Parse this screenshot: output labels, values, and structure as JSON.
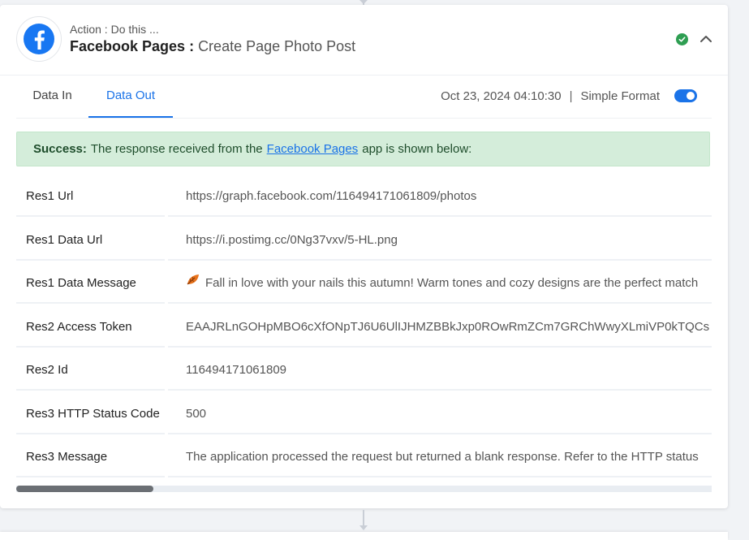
{
  "header": {
    "action_caption": "Action : Do this ...",
    "app_name": "Facebook Pages",
    "separator": " : ",
    "event_name": "Create Page Photo Post",
    "brand_color": "#1877f2",
    "status_color": "#2e9e52"
  },
  "tabs": [
    {
      "label": "Data In",
      "active": false
    },
    {
      "label": "Data Out",
      "active": true
    }
  ],
  "meta": {
    "timestamp": "Oct 23, 2024 04:10:30",
    "pipe": "|",
    "format_label": "Simple Format",
    "simple_format_on": true
  },
  "success": {
    "prefix": "Success:",
    "text_before": "The response received from the",
    "link_text": "Facebook Pages",
    "text_after": "app is shown below:"
  },
  "rows": [
    {
      "key": "Res1 Url",
      "value": "https://graph.facebook.com/116494171061809/photos"
    },
    {
      "key": "Res1 Data Url",
      "value": "https://i.postimg.cc/0Ng37vxv/5-HL.png"
    },
    {
      "key": "Res1 Data Message",
      "value": "Fall in love with your nails this autumn! Warm tones and cozy designs are the perfect match",
      "icon": "autumn-leaf-icon"
    },
    {
      "key": "Res2 Access Token",
      "value": "EAAJRLnGOHpMBO6cXfONpTJ6U6UlIJHMZBBkJxp0ROwRmZCm7GRChWwyXLmiVP0kTQCs"
    },
    {
      "key": "Res2 Id",
      "value": "116494171061809"
    },
    {
      "key": "Res3 HTTP Status Code",
      "value": "500"
    },
    {
      "key": "Res3 Message",
      "value": "The application processed the request but returned a blank response. Refer to the HTTP status"
    }
  ]
}
